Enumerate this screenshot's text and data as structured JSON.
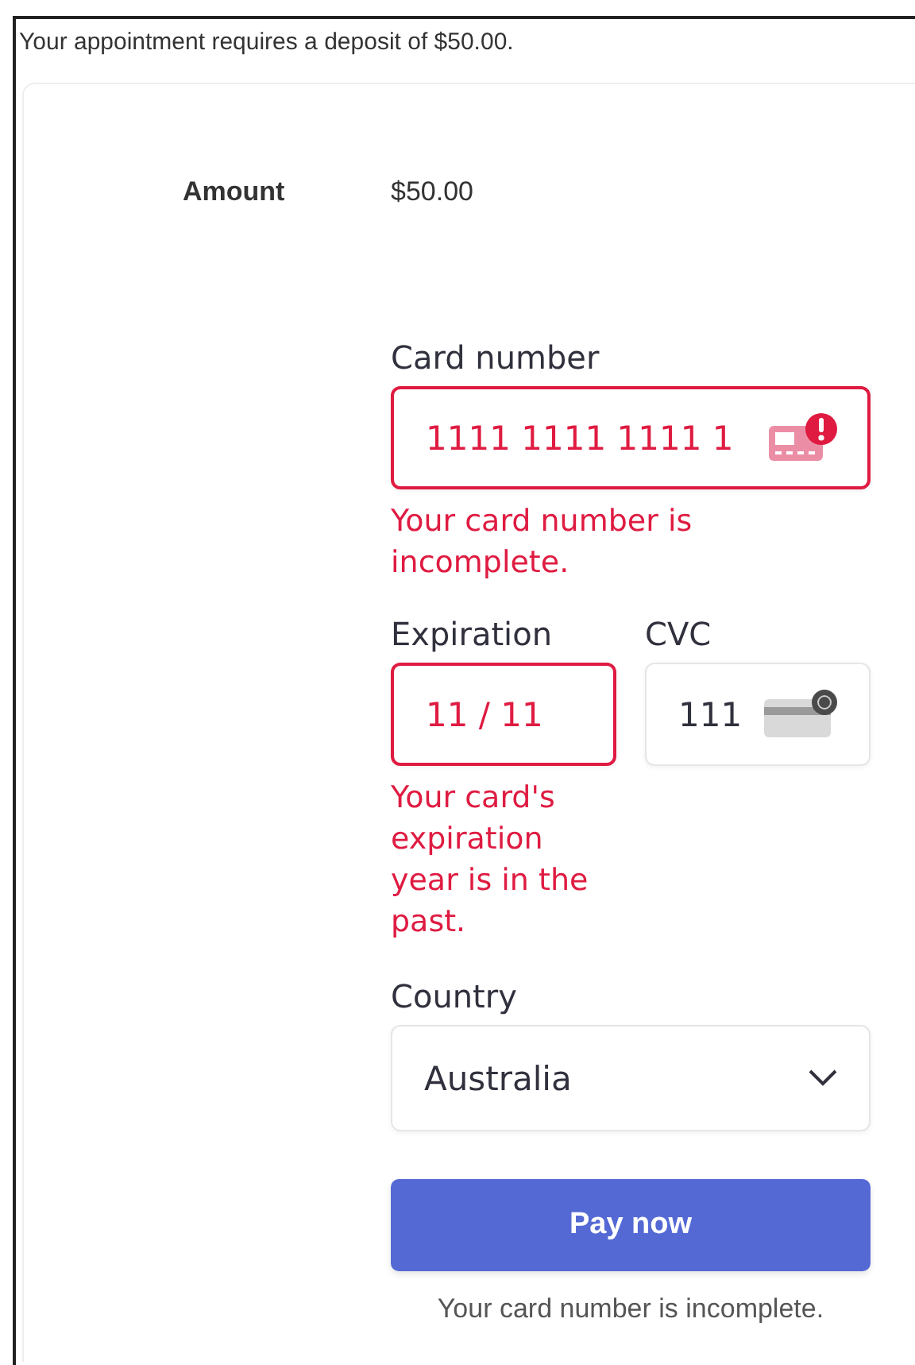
{
  "notice": "Your appointment requires a deposit of $50.00.",
  "amount": {
    "label": "Amount",
    "value": "$50.00"
  },
  "fields": [
    {
      "kind": "card",
      "label": "Card number",
      "value": "1111 1111 1111 1",
      "invalid": true,
      "error": "Your card number is incomplete."
    },
    {
      "kind": "expiry",
      "label": "Expiration",
      "value": "11 / 11",
      "invalid": true,
      "error": "Your card's expiration year is in the past."
    },
    {
      "kind": "cvc",
      "label": "CVC",
      "value": "111",
      "invalid": false
    }
  ],
  "country": {
    "label": "Country",
    "value": "Australia"
  },
  "pay_button": "Pay now",
  "status": "Your card number is incomplete."
}
